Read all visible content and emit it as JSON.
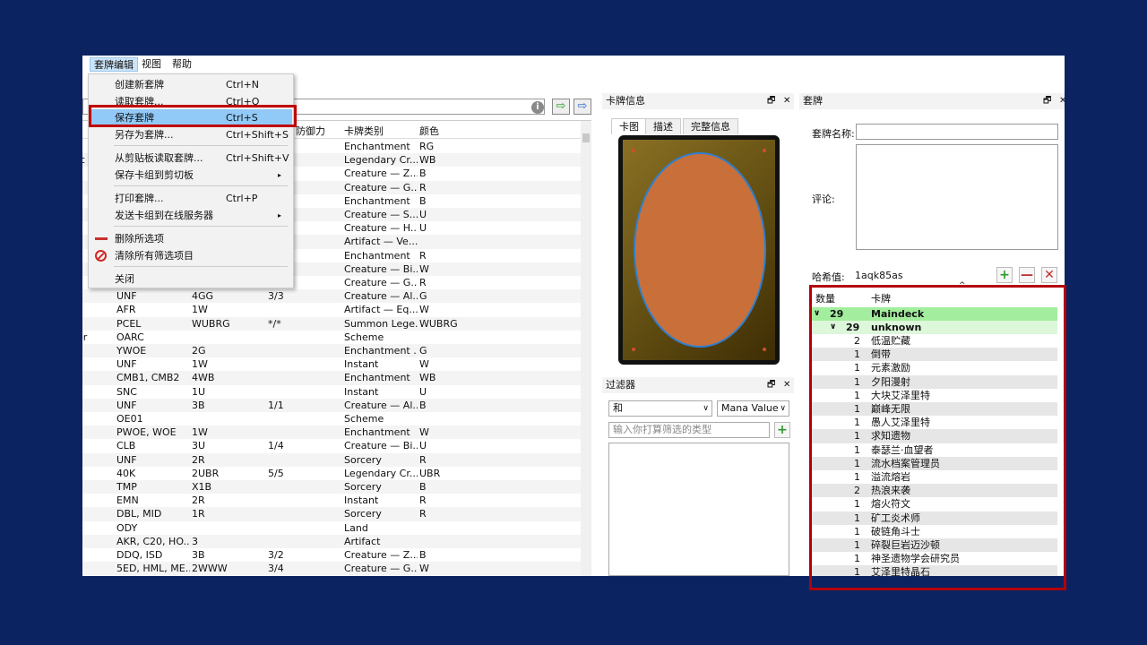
{
  "menubar": {
    "items": [
      "套牌编辑",
      "视图",
      "帮助"
    ]
  },
  "menu": {
    "items": [
      {
        "label": "创建新套牌",
        "shortcut": "Ctrl+N"
      },
      {
        "label": "读取套牌...",
        "shortcut": "Ctrl+O"
      },
      {
        "label": "保存套牌",
        "shortcut": "Ctrl+S"
      },
      {
        "label": "另存为套牌...",
        "shortcut": "Ctrl+Shift+S"
      },
      {
        "label": "从剪贴板读取套牌...",
        "shortcut": "Ctrl+Shift+V"
      },
      {
        "label": "保存卡组到剪切板",
        "shortcut": ""
      },
      {
        "label": "打印套牌...",
        "shortcut": "Ctrl+P"
      },
      {
        "label": "发送卡组到在线服务器",
        "shortcut": ""
      },
      {
        "label": "删除所选项",
        "shortcut": ""
      },
      {
        "label": "清除所有筛选项目",
        "shortcut": ""
      },
      {
        "label": "关闭",
        "shortcut": ""
      }
    ],
    "submenu_glyph": "▸"
  },
  "table": {
    "headers": {
      "toughness": "防御力",
      "type": "卡牌类别",
      "color": "颜色"
    },
    "rows": [
      {
        "left": "",
        "set": "",
        "cost": "",
        "pt": "",
        "type": "Enchantment",
        "color": "RG"
      },
      {
        "left": "lc",
        "set": "",
        "cost": "",
        "pt": "",
        "type": "Legendary Cr...",
        "color": "WB"
      },
      {
        "left": "",
        "set": "",
        "cost": "",
        "pt": "",
        "type": "Creature — Z...",
        "color": "B"
      },
      {
        "left": "",
        "set": "",
        "cost": "",
        "pt": "",
        "type": "Creature — G...",
        "color": "R"
      },
      {
        "left": "",
        "set": "",
        "cost": "",
        "pt": "",
        "type": "Enchantment",
        "color": "B"
      },
      {
        "left": "",
        "set": "",
        "cost": "",
        "pt": "",
        "type": "Creature — S...",
        "color": "U"
      },
      {
        "left": "",
        "set": "",
        "cost": "",
        "pt": "",
        "type": "Creature — H...",
        "color": "U"
      },
      {
        "left": "",
        "set": "",
        "cost": "",
        "pt": "",
        "type": "Artifact — Ve...",
        "color": ""
      },
      {
        "left": "",
        "set": "",
        "cost": "",
        "pt": "",
        "type": "Enchantment",
        "color": "R"
      },
      {
        "left": "",
        "set": "",
        "cost": "",
        "pt": "",
        "type": "Creature — Bi...",
        "color": "W"
      },
      {
        "left": "",
        "set": "",
        "cost": "",
        "pt": "",
        "type": "Creature — G...",
        "color": "R"
      },
      {
        "left": "",
        "set": "UNF",
        "cost": "4GG",
        "pt": "3/3",
        "type": "Creature — Al...",
        "color": "G"
      },
      {
        "left": "",
        "set": "AFR",
        "cost": "1W",
        "pt": "",
        "type": "Artifact — Eq...",
        "color": "W"
      },
      {
        "left": "",
        "set": "PCEL",
        "cost": "WUBRG",
        "pt": "*/*",
        "type": "Summon Lege...",
        "color": "WUBRG"
      },
      {
        "left": "er",
        "set": "OARC",
        "cost": "",
        "pt": "",
        "type": "Scheme",
        "color": ""
      },
      {
        "left": "",
        "set": "YWOE",
        "cost": "2G",
        "pt": "",
        "type": "Enchantment ...",
        "color": "G"
      },
      {
        "left": "",
        "set": "UNF",
        "cost": "1W",
        "pt": "",
        "type": "Instant",
        "color": "W"
      },
      {
        "left": "",
        "set": "CMB1, CMB2",
        "cost": "4WB",
        "pt": "",
        "type": "Enchantment",
        "color": "WB"
      },
      {
        "left": "",
        "set": "SNC",
        "cost": "1U",
        "pt": "",
        "type": "Instant",
        "color": "U"
      },
      {
        "left": "",
        "set": "UNF",
        "cost": "3B",
        "pt": "1/1",
        "type": "Creature — Al...",
        "color": "B"
      },
      {
        "left": "",
        "set": "OE01",
        "cost": "",
        "pt": "",
        "type": "Scheme",
        "color": ""
      },
      {
        "left": "",
        "set": "PWOE, WOE",
        "cost": "1W",
        "pt": "",
        "type": "Enchantment",
        "color": "W"
      },
      {
        "left": "",
        "set": "CLB",
        "cost": "3U",
        "pt": "1/4",
        "type": "Creature — Bi...",
        "color": "U"
      },
      {
        "left": "",
        "set": "UNF",
        "cost": "2R",
        "pt": "",
        "type": "Sorcery",
        "color": "R"
      },
      {
        "left": "",
        "set": "40K",
        "cost": "2UBR",
        "pt": "5/5",
        "type": "Legendary Cr...",
        "color": "UBR"
      },
      {
        "left": "",
        "set": "TMP",
        "cost": "X1B",
        "pt": "",
        "type": "Sorcery",
        "color": "B"
      },
      {
        "left": "",
        "set": "EMN",
        "cost": "2R",
        "pt": "",
        "type": "Instant",
        "color": "R"
      },
      {
        "left": "",
        "set": "DBL, MID",
        "cost": "1R",
        "pt": "",
        "type": "Sorcery",
        "color": "R"
      },
      {
        "left": "",
        "set": "ODY",
        "cost": "",
        "pt": "",
        "type": "Land",
        "color": ""
      },
      {
        "left": "",
        "set": "AKR, C20, HO...",
        "cost": "3",
        "pt": "",
        "type": "Artifact",
        "color": ""
      },
      {
        "left": "",
        "set": "DDQ, ISD",
        "cost": "3B",
        "pt": "3/2",
        "type": "Creature — Z...",
        "color": "B"
      },
      {
        "left": "",
        "set": "5ED, HML, ME...",
        "cost": "2WWW",
        "pt": "3/4",
        "type": "Creature — G...",
        "color": "W"
      }
    ]
  },
  "card_info": {
    "title": "卡牌信息",
    "tabs": [
      "卡图",
      "描述",
      "完整信息"
    ]
  },
  "filter": {
    "title": "过滤器",
    "logic": "和",
    "field": "Mana Value",
    "placeholder": "输入你打算筛选的类型"
  },
  "deck": {
    "title": "套牌",
    "name_label": "套牌名称:",
    "comment_label": "评论:",
    "hash_label": "哈希值:",
    "hash_value": "1aqk85as",
    "col_count": "数量",
    "col_card": "卡牌",
    "group": {
      "count": "29",
      "name": "Maindeck"
    },
    "subgroup": {
      "count": "29",
      "name": "unknown"
    },
    "cards": [
      {
        "n": "2",
        "name": "低温贮藏"
      },
      {
        "n": "1",
        "name": "倒带"
      },
      {
        "n": "1",
        "name": "元素激励"
      },
      {
        "n": "1",
        "name": "夕阳漫射"
      },
      {
        "n": "1",
        "name": "大块艾泽里特"
      },
      {
        "n": "1",
        "name": "巅峰无限"
      },
      {
        "n": "1",
        "name": "愚人艾泽里特"
      },
      {
        "n": "1",
        "name": "求知遗物"
      },
      {
        "n": "1",
        "name": "泰瑟兰·血望者"
      },
      {
        "n": "1",
        "name": "流水档案管理员"
      },
      {
        "n": "1",
        "name": "溢流熔岩"
      },
      {
        "n": "2",
        "name": "热浪来袭"
      },
      {
        "n": "1",
        "name": "熔火符文"
      },
      {
        "n": "1",
        "name": "矿工炎术师"
      },
      {
        "n": "1",
        "name": "破链角斗士"
      },
      {
        "n": "1",
        "name": "碎裂巨岩迈沙顿"
      },
      {
        "n": "1",
        "name": "神圣遗物学会研究员"
      },
      {
        "n": "1",
        "name": "艾泽里特晶石"
      }
    ]
  },
  "glyphs": {
    "float": "🗗",
    "close": "✕",
    "plus": "+",
    "minus": "—",
    "x": "✕",
    "expand": "∨",
    "caret": "^",
    "info": "i",
    "arrow": "⇨",
    "chev": "∨"
  }
}
